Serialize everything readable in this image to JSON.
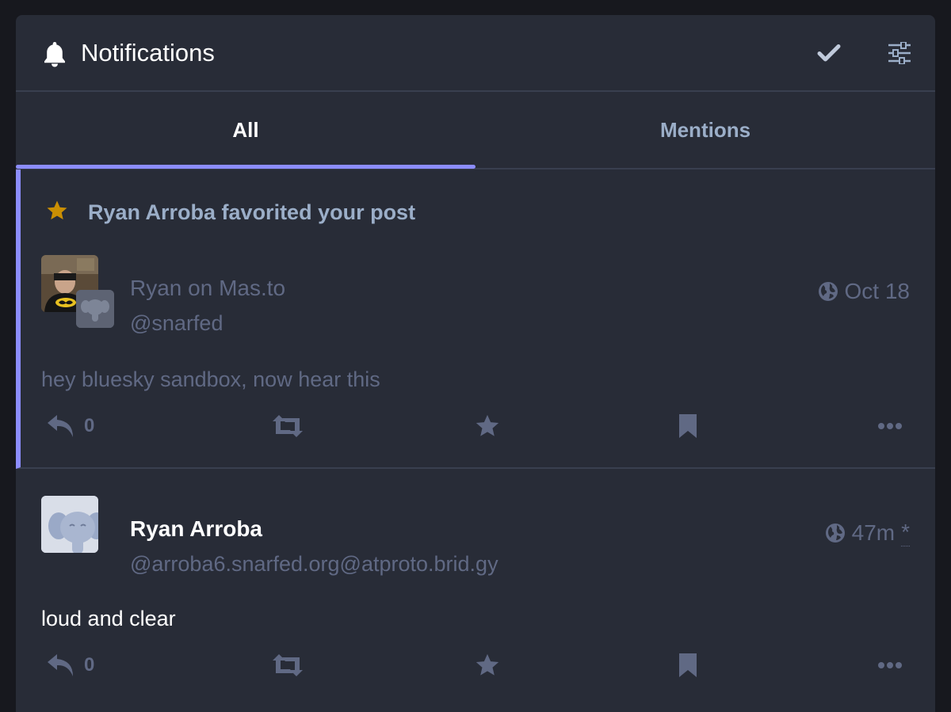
{
  "header": {
    "title": "Notifications",
    "icon": "bell-icon",
    "mark_read_icon": "check-icon",
    "settings_icon": "sliders-icon"
  },
  "tabs": [
    {
      "label": "All",
      "active": true
    },
    {
      "label": "Mentions",
      "active": false
    }
  ],
  "notifications": [
    {
      "type_icon": "star-icon",
      "text": "Ryan Arroba favorited your post",
      "status": {
        "display_name": "Ryan on Mas.to",
        "acct": "@snarfed",
        "visibility_icon": "globe-icon",
        "time": "Oct 18",
        "content": "hey bluesky sandbox, now hear this",
        "reply_count": "0"
      }
    }
  ],
  "statuses": [
    {
      "display_name": "Ryan Arroba",
      "acct": "@arroba6.snarfed.org@atproto.brid.gy",
      "visibility_icon": "globe-icon",
      "time": "47m",
      "edited_marker": "*",
      "content": "loud and clear",
      "reply_count": "0"
    }
  ],
  "colors": {
    "accent": "#8c8dff",
    "background": "#282c37",
    "muted": "#606984",
    "secondary": "#9baec8",
    "star": "#ca8f04"
  }
}
